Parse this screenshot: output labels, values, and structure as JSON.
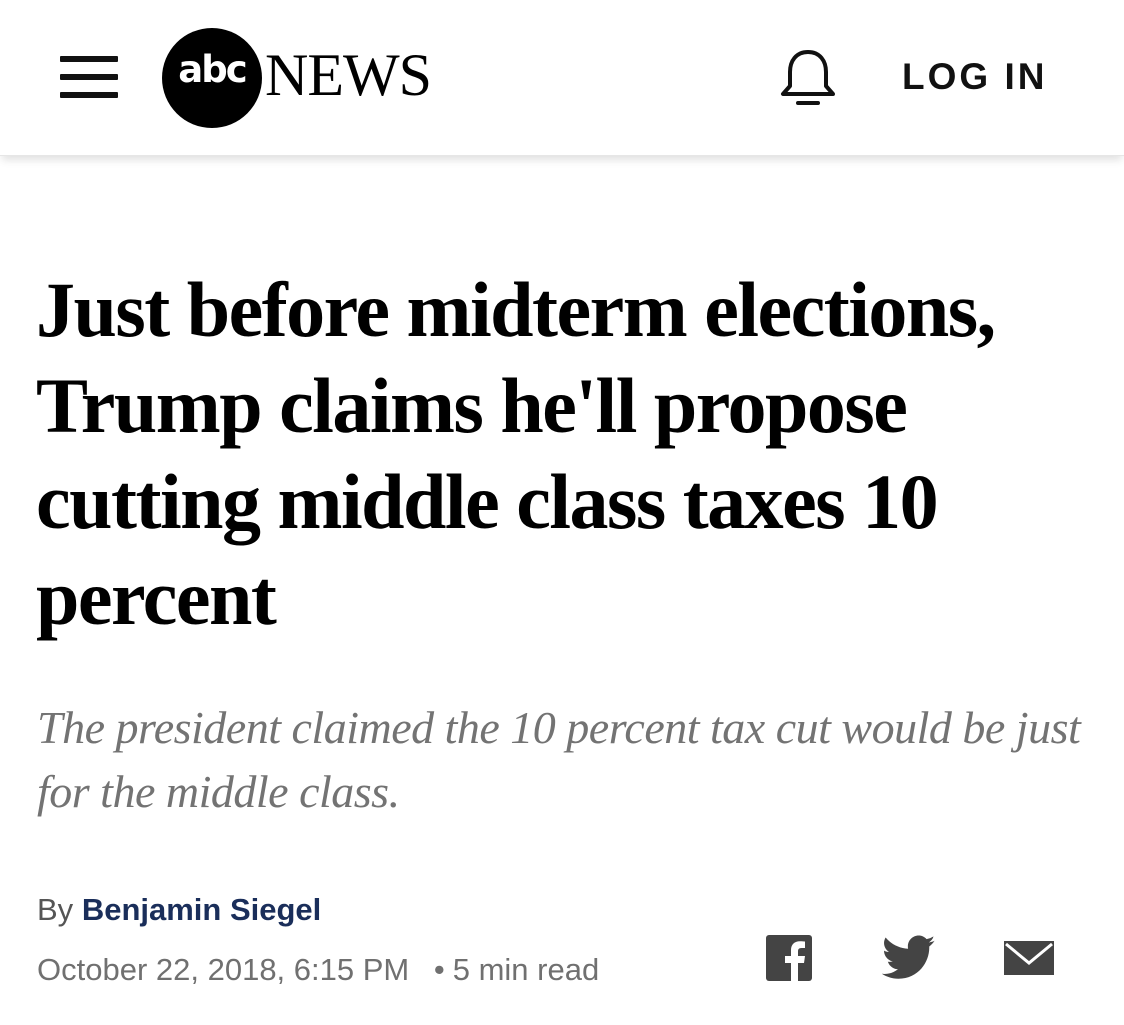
{
  "header": {
    "menu_icon": "hamburger-menu-icon",
    "logo_abc": "abc",
    "logo_news": "NEWS",
    "bell_icon": "bell-icon",
    "login_label": "LOG IN"
  },
  "article": {
    "headline": "Just before midterm elections, Trump claims he'll propose cutting middle class taxes 10 percent",
    "subheadline": "The president claimed the 10 percent tax cut would be just for the middle class.",
    "byline_prefix": "By",
    "author": "Benjamin Siegel",
    "date": "October 22, 2018, 6:15 PM",
    "separator": "•",
    "read_time": "5 min read"
  },
  "share": {
    "icons": [
      "facebook-icon",
      "twitter-icon",
      "email-icon"
    ]
  },
  "colors": {
    "author": "#1a2e5a",
    "subhead": "#737373",
    "meta": "#707070"
  }
}
